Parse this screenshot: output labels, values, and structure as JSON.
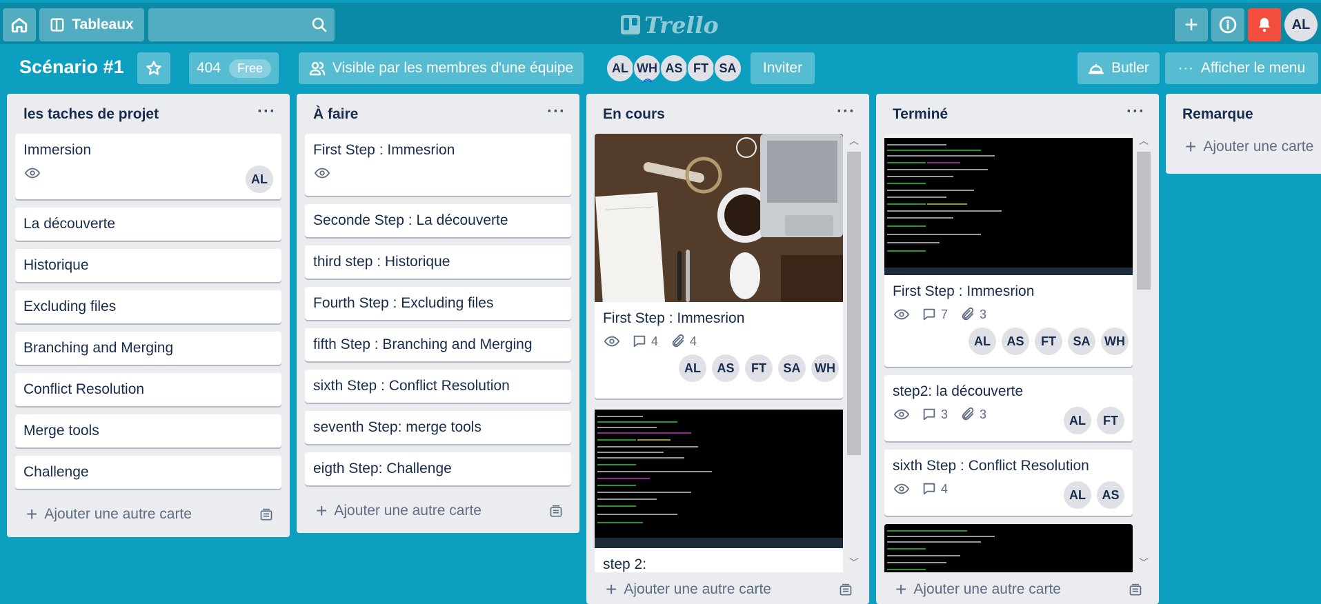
{
  "header": {
    "boards_label": "Tableaux",
    "search_value": "",
    "logo_text": "Trello",
    "user_initials": "AL"
  },
  "board": {
    "title": "Scénario #1",
    "team_name": "404",
    "plan_badge": "Free",
    "visibility": "Visible par les membres d'une équipe",
    "members": [
      "AL",
      "WH",
      "AS",
      "FT",
      "SA"
    ],
    "invite_label": "Inviter",
    "butler_label": "Butler",
    "menu_label": "Afficher le menu"
  },
  "add_card_label": "Ajouter une autre carte",
  "lists": [
    {
      "title": "les taches de projet",
      "cards": [
        {
          "title": "Immersion",
          "member": "AL"
        },
        {
          "title": "La découverte"
        },
        {
          "title": "Historique"
        },
        {
          "title": "Excluding files"
        },
        {
          "title": "Branching and Merging"
        },
        {
          "title": "Conflict Resolution"
        },
        {
          "title": "Merge tools"
        },
        {
          "title": "Challenge"
        }
      ]
    },
    {
      "title": "À faire",
      "cards": [
        {
          "title": "First Step : Immesrion"
        },
        {
          "title": "Seconde Step : La découverte"
        },
        {
          "title": "third step : Historique"
        },
        {
          "title": "Fourth Step : Excluding files"
        },
        {
          "title": "fifth Step : Branching and Merging"
        },
        {
          "title": "sixth Step : Conflict Resolution"
        },
        {
          "title": "seventh Step: merge tools"
        },
        {
          "title": "eigth Step: Challenge"
        }
      ]
    },
    {
      "title": "En cours",
      "cards": [
        {
          "title": "First Step : Immesrion",
          "comments": "4",
          "attachments": "4",
          "members": [
            "AL",
            "AS",
            "FT",
            "SA",
            "WH"
          ]
        },
        {
          "title": "step 2:"
        }
      ]
    },
    {
      "title": "Terminé",
      "cards": [
        {
          "title": "First Step : Immesrion",
          "comments": "7",
          "attachments": "3",
          "members": [
            "AL",
            "AS",
            "FT",
            "SA",
            "WH"
          ]
        },
        {
          "title": "step2: la découverte",
          "comments": "3",
          "attachments": "3",
          "members": [
            "AL",
            "FT"
          ]
        },
        {
          "title": "sixth Step : Conflict Resolution",
          "comments": "4",
          "members": [
            "AL",
            "AS"
          ]
        }
      ]
    },
    {
      "title": "Remarque",
      "add_label": "Ajouter une carte"
    }
  ]
}
